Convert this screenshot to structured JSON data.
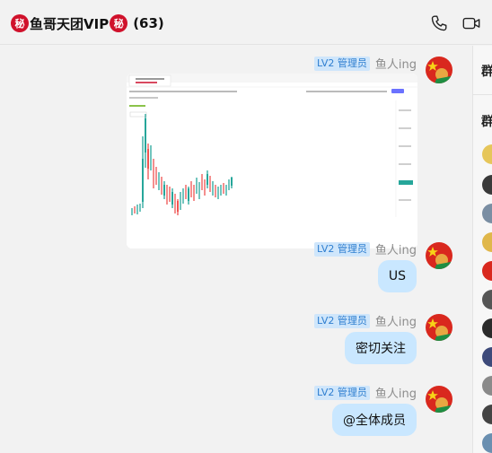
{
  "header": {
    "secret_badge": "秘",
    "group_name": "鱼哥天团VIP",
    "member_count": "(63)",
    "phone_icon": "phone-icon",
    "video_icon": "video-icon"
  },
  "side_panel": {
    "title_1": "群",
    "title_2": "群"
  },
  "messages": [
    {
      "type": "image",
      "badge": "LV2 管理员",
      "sender": "鱼人ing",
      "caption": "price chart screenshot"
    },
    {
      "type": "text",
      "badge": "LV2 管理员",
      "sender": "鱼人ing",
      "text": "US"
    },
    {
      "type": "text",
      "badge": "LV2 管理员",
      "sender": "鱼人ing",
      "text": "密切关注"
    },
    {
      "type": "text",
      "badge": "LV2 管理员",
      "sender": "鱼人ing",
      "text": "@全体成员"
    }
  ],
  "colors": {
    "bubble": "#c9e7ff",
    "badge_bg": "#cfe6fb",
    "badge_text": "#2f7fd0",
    "secret_red": "#d0112b"
  }
}
